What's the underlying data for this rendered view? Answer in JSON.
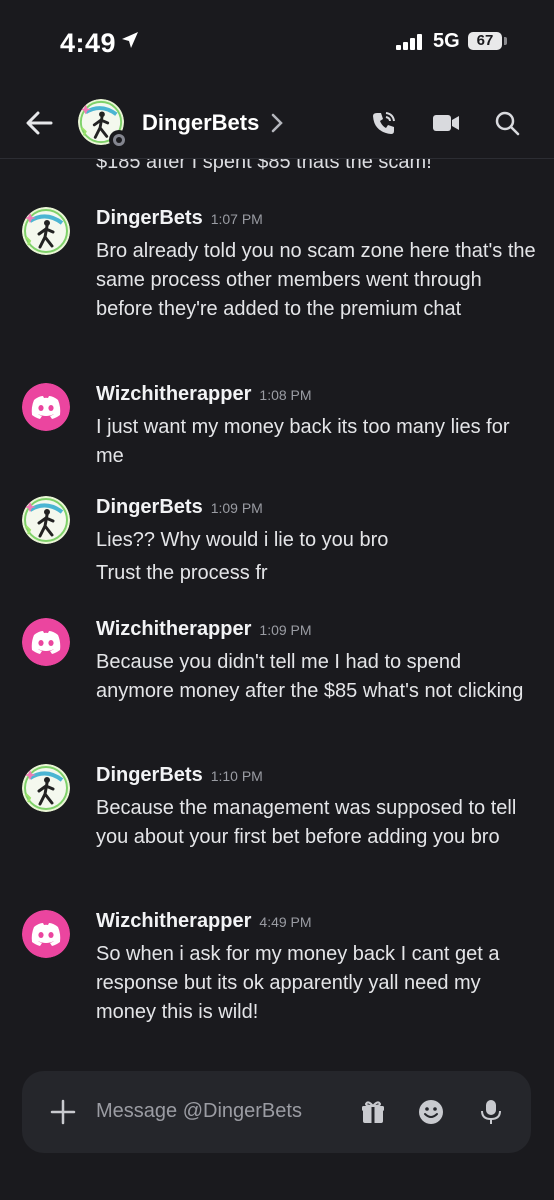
{
  "status_bar": {
    "time": "4:49",
    "network": "5G",
    "battery": "67"
  },
  "header": {
    "channel_name": "DingerBets"
  },
  "messages": {
    "cut_off_text": "$185 after I spent $85 thats the scam!",
    "items": [
      {
        "author": "DingerBets",
        "time": "1:07 PM",
        "avatar": "dingerbets-avatar",
        "lines": [
          "Bro already told you no scam zone here that's the same process other members went through before they're added to the premium chat"
        ]
      },
      {
        "author": "Wizchitherapper",
        "time": "1:08 PM",
        "avatar": "discord-default-avatar",
        "lines": [
          "I just want my money back its too many lies for me"
        ]
      },
      {
        "author": "DingerBets",
        "time": "1:09 PM",
        "avatar": "dingerbets-avatar",
        "lines": [
          "Lies?? Why would i lie to you bro",
          "Trust the process fr"
        ]
      },
      {
        "author": "Wizchitherapper",
        "time": "1:09 PM",
        "avatar": "discord-default-avatar",
        "lines": [
          "Because you didn't tell me I had to spend anymore money after the $85 what's not clicking"
        ]
      },
      {
        "author": "DingerBets",
        "time": "1:10 PM",
        "avatar": "dingerbets-avatar",
        "lines": [
          "Because the management was supposed to tell you about your first bet before adding you bro"
        ]
      },
      {
        "author": "Wizchitherapper",
        "time": "4:49 PM",
        "avatar": "discord-default-avatar",
        "lines": [
          "So when i ask for my money back I cant get a response but its ok apparently yall need my money this is wild!"
        ]
      }
    ]
  },
  "composer": {
    "placeholder": "Message @DingerBets"
  },
  "icons": {
    "back": "arrow-left-icon",
    "call": "phone-icon",
    "video": "video-camera-icon",
    "search": "search-icon",
    "plus": "plus-icon",
    "gift": "gift-icon",
    "emoji": "emoji-icon",
    "mic": "microphone-icon"
  },
  "colors": {
    "background": "#1a1a1e",
    "discord_avatar": "#eb459f",
    "composer": "#25262b",
    "accent_green": "#3ba55d"
  }
}
